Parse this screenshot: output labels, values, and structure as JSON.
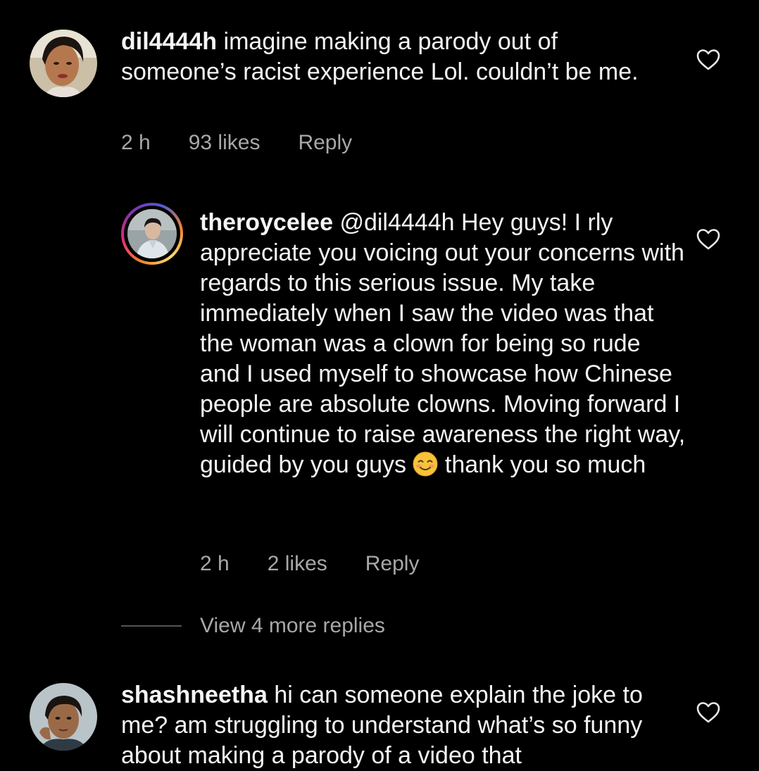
{
  "comments": [
    {
      "username": "dil4444h",
      "text": "imagine making a parody out of someone’s racist experience Lol. couldn’t be me.",
      "time": "2 h",
      "likes": "93 likes",
      "reply_label": "Reply",
      "liked": false
    },
    {
      "username": "theroycelee",
      "mention": "@dil4444h",
      "text_before_emoji": "Hey guys! I rly appreciate you voicing out your concerns with regards to this serious issue. My take immediately when I saw the video was that the woman was a clown for being so rude and I used myself to showcase how Chinese people are absolute clowns. Moving forward I will continue to raise awareness the right way, guided by you guys",
      "emoji": "smiling-face-emoji",
      "text_after_emoji": "thank you so much",
      "time": "2 h",
      "likes": "2 likes",
      "reply_label": "Reply",
      "liked": false,
      "has_story_ring": true
    },
    {
      "username": "shashneetha",
      "text": "hi can someone explain the joke to me? am struggling to understand what’s so funny about making a parody of a video that",
      "liked": false
    }
  ],
  "view_more_replies": "View 4 more replies",
  "icons": {
    "like": "heart-outline-icon"
  },
  "colors": {
    "background": "#000000",
    "text": "#f5f5f5",
    "secondary": "#a8a8a8"
  }
}
